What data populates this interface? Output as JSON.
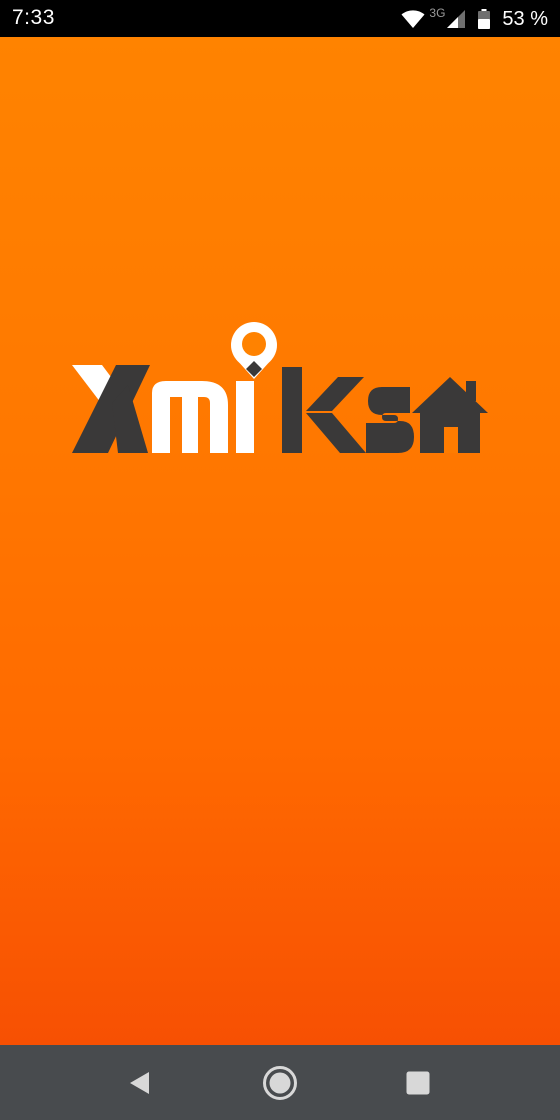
{
  "status_bar": {
    "time": "7:33",
    "network_type": "3G",
    "battery_text": "53 %",
    "icons": [
      "wifi-icon",
      "signal-icon",
      "battery-icon"
    ]
  },
  "splash": {
    "logo_text": "XmiKsa",
    "logo_icons": [
      "location-pin-icon",
      "house-icon"
    ]
  },
  "nav_bar": {
    "icons": [
      "back-icon",
      "home-icon",
      "recents-icon"
    ]
  },
  "colors": {
    "status_bar_bg": "#000000",
    "splash_top": "#ff8300",
    "splash_bottom": "#f75003",
    "logo_dark": "#3a3939",
    "logo_light": "#ffffff",
    "nav_bar_bg": "#484b4e",
    "nav_icon": "#d8d8d8"
  }
}
